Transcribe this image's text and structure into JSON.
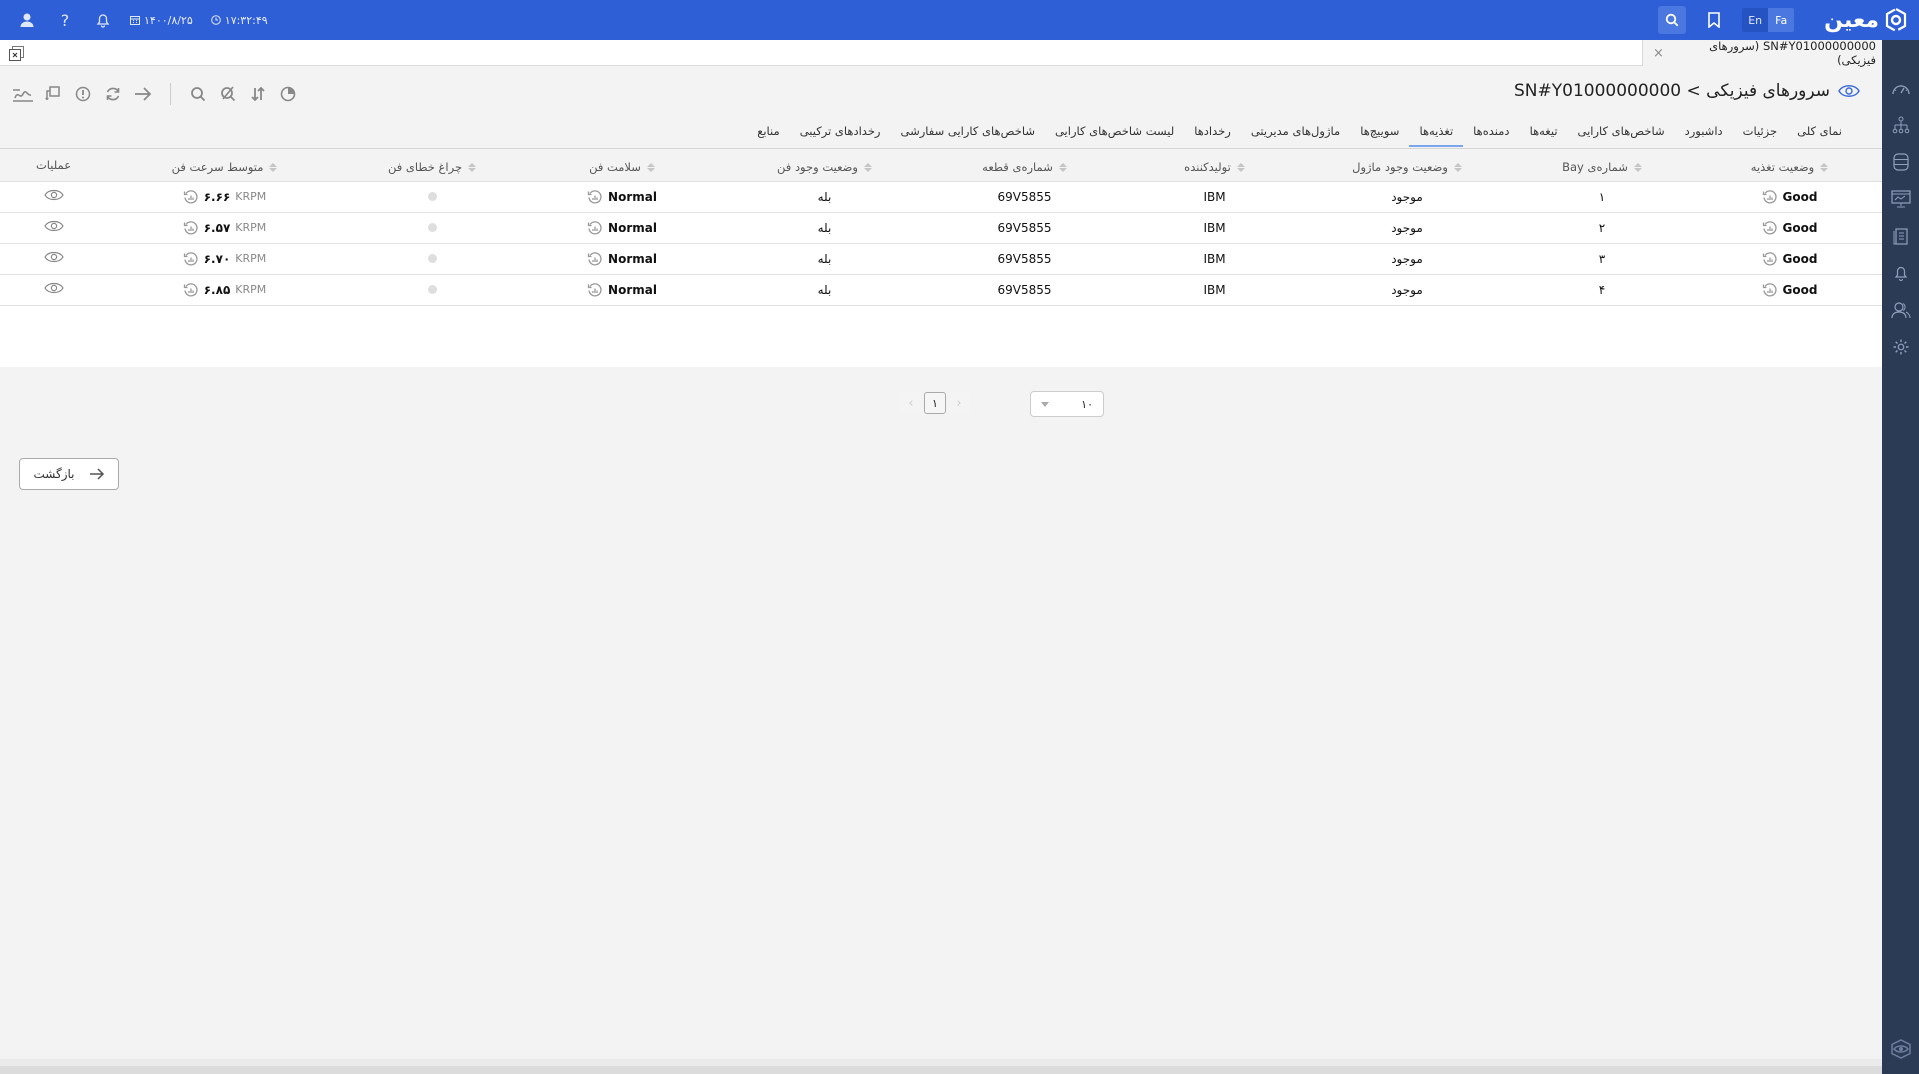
{
  "topbar": {
    "logo_text": "معین",
    "lang_en": "En",
    "lang_fa": "Fa",
    "date": "۱۴۰۰/۸/۲۵",
    "time": "۱۷:۳۲:۴۹",
    "brand_color": "#2f5fd7"
  },
  "tabstrip": {
    "open_tab_label": "SN#Y01000000000 (سرورهای فیزیکی)",
    "close_symbol": "×"
  },
  "page": {
    "title": "سرورهای فیزیکی > SN#Y01000000000"
  },
  "nav_tabs": [
    {
      "label": "نمای کلی",
      "active": false
    },
    {
      "label": "جزئیات",
      "active": false
    },
    {
      "label": "داشبورد",
      "active": false
    },
    {
      "label": "شاخص‌های کارایی",
      "active": false
    },
    {
      "label": "تیغه‌ها",
      "active": false
    },
    {
      "label": "دمنده‌ها",
      "active": false
    },
    {
      "label": "تغذیه‌ها",
      "active": true
    },
    {
      "label": "سوییچ‌ها",
      "active": false
    },
    {
      "label": "ماژول‌های مدیریتی",
      "active": false
    },
    {
      "label": "رخدادها",
      "active": false
    },
    {
      "label": "لیست شاخص‌های کارایی",
      "active": false
    },
    {
      "label": "شاخص‌های کارایی سفارشی",
      "active": false
    },
    {
      "label": "رخدادهای ترکیبی",
      "active": false
    },
    {
      "label": "منابع",
      "active": false
    }
  ],
  "table": {
    "columns": [
      {
        "label": "وضعیت تغذیه",
        "sortable": true
      },
      {
        "label": "شماره‌ی Bay",
        "sortable": true
      },
      {
        "label": "وضعیت وجود ماژول",
        "sortable": true
      },
      {
        "label": "تولیدکننده",
        "sortable": true
      },
      {
        "label": "شماره‌ی قطعه",
        "sortable": true
      },
      {
        "label": "وضعیت وجود فن",
        "sortable": true
      },
      {
        "label": "سلامت فن",
        "sortable": true
      },
      {
        "label": "چراغ خطای فن",
        "sortable": true
      },
      {
        "label": "متوسط سرعت فن",
        "sortable": true
      },
      {
        "label": "عملیات",
        "sortable": false
      }
    ],
    "rows": [
      {
        "power_status": "Good",
        "bay": "۱",
        "module_presence": "موجود",
        "manufacturer": "IBM",
        "part_number": "69V5855",
        "fan_presence": "بله",
        "fan_health": "Normal",
        "fan_speed": "۶.۶۶",
        "fan_speed_unit": "KRPM"
      },
      {
        "power_status": "Good",
        "bay": "۲",
        "module_presence": "موجود",
        "manufacturer": "IBM",
        "part_number": "69V5855",
        "fan_presence": "بله",
        "fan_health": "Normal",
        "fan_speed": "۶.۵۷",
        "fan_speed_unit": "KRPM"
      },
      {
        "power_status": "Good",
        "bay": "۳",
        "module_presence": "موجود",
        "manufacturer": "IBM",
        "part_number": "69V5855",
        "fan_presence": "بله",
        "fan_health": "Normal",
        "fan_speed": "۶.۷۰",
        "fan_speed_unit": "KRPM"
      },
      {
        "power_status": "Good",
        "bay": "۴",
        "module_presence": "موجود",
        "manufacturer": "IBM",
        "part_number": "69V5855",
        "fan_presence": "بله",
        "fan_health": "Normal",
        "fan_speed": "۶.۸۵",
        "fan_speed_unit": "KRPM"
      }
    ]
  },
  "pagination": {
    "current_page": "۱",
    "prev_symbol": "‹",
    "next_symbol": "›",
    "page_size": "۱۰"
  },
  "back_button": {
    "label": "بازگشت"
  },
  "toolbar_icons": [
    "chart-icon",
    "filter-icon",
    "alert-icon",
    "refresh-icon",
    "arrow-right-icon",
    "search-icon",
    "search-off-icon",
    "sort-icon",
    "pie-icon"
  ],
  "sidebar_icons": [
    "gauge-icon",
    "hierarchy-icon",
    "database-icon",
    "monitor-icon",
    "clipboard-icon",
    "bell-icon",
    "users-icon",
    "settings-icon"
  ]
}
